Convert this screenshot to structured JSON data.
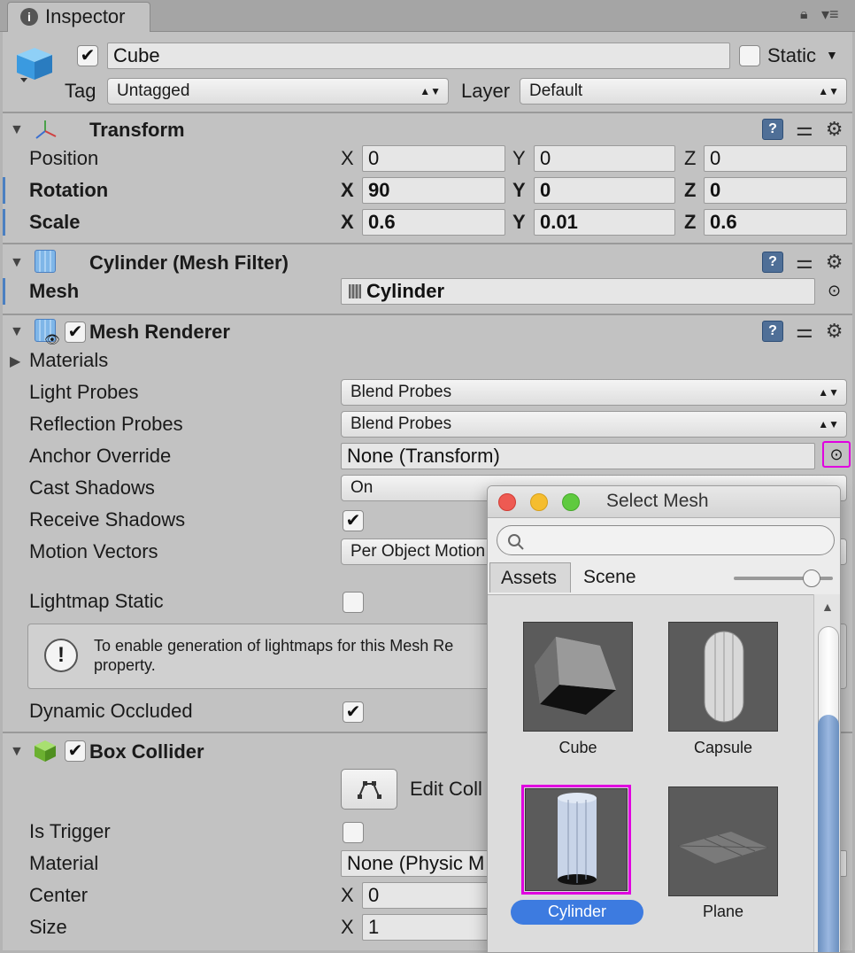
{
  "tab": {
    "title": "Inspector"
  },
  "object": {
    "name": "Cube",
    "static_label": "Static",
    "tag_label": "Tag",
    "tag_value": "Untagged",
    "layer_label": "Layer",
    "layer_value": "Default"
  },
  "transform": {
    "title": "Transform",
    "position": {
      "label": "Position",
      "x": "0",
      "y": "0",
      "z": "0"
    },
    "rotation": {
      "label": "Rotation",
      "x": "90",
      "y": "0",
      "z": "0"
    },
    "scale": {
      "label": "Scale",
      "x": "0.6",
      "y": "0.01",
      "z": "0.6"
    },
    "axis_x": "X",
    "axis_y": "Y",
    "axis_z": "Z"
  },
  "mesh_filter": {
    "title": "Cylinder (Mesh Filter)",
    "mesh_label": "Mesh",
    "mesh_value": "Cylinder"
  },
  "mesh_renderer": {
    "title": "Mesh Renderer",
    "materials": "Materials",
    "light_probes": {
      "label": "Light Probes",
      "value": "Blend Probes"
    },
    "reflection_probes": {
      "label": "Reflection Probes",
      "value": "Blend Probes"
    },
    "anchor_override": {
      "label": "Anchor Override",
      "value": "None (Transform)"
    },
    "cast_shadows": {
      "label": "Cast Shadows",
      "value": "On"
    },
    "receive_shadows": {
      "label": "Receive Shadows"
    },
    "motion_vectors": {
      "label": "Motion Vectors",
      "value": "Per Object Motion"
    },
    "lightmap_static": {
      "label": "Lightmap Static"
    },
    "help_text_line1": "To enable generation of lightmaps for this Mesh Re",
    "help_text_line2": "property.",
    "dynamic_occluded": {
      "label": "Dynamic Occluded"
    }
  },
  "box_collider": {
    "title": "Box Collider",
    "edit_collider": "Edit Coll",
    "is_trigger": "Is Trigger",
    "material": {
      "label": "Material",
      "value": "None (Physic M"
    },
    "center": {
      "label": "Center",
      "x": "0"
    },
    "size": {
      "label": "Size",
      "x": "1"
    }
  },
  "select_mesh": {
    "title": "Select Mesh",
    "search_placeholder": "",
    "tabs": [
      "Assets",
      "Scene"
    ],
    "zoom_slider": 0.85,
    "items": [
      {
        "name": "Cube",
        "selected": false
      },
      {
        "name": "Capsule",
        "selected": false
      },
      {
        "name": "Cylinder",
        "selected": true
      },
      {
        "name": "Plane",
        "selected": false
      }
    ]
  },
  "colors": {
    "accent": "#4a7fc1",
    "highlight": "#e000e0",
    "selected_bg": "#3d7be0"
  }
}
